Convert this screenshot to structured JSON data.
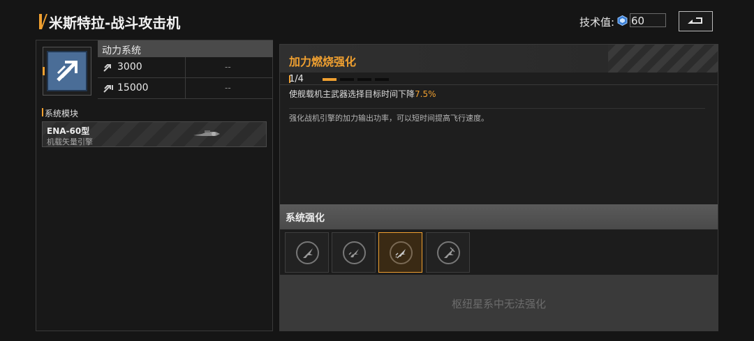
{
  "header": {
    "title": "米斯特拉-战斗攻击机",
    "tech_label": "技术值:",
    "tech_value": "60",
    "back_icon": "back-arrow-icon"
  },
  "left": {
    "system_title": "动力系统",
    "stats": [
      {
        "icon": "thrust-icon",
        "value": "3000",
        "other": "--"
      },
      {
        "icon": "boost-thrust-icon",
        "value": "15000",
        "other": "--"
      }
    ],
    "module_section_label": "系统模块",
    "module": {
      "name": "ENA-60型",
      "subtitle": "机载矢量引擎"
    }
  },
  "right": {
    "title": "加力燃烧强化",
    "level": "1/4",
    "level_progress": {
      "current": 1,
      "max": 4
    },
    "effect_prefix": "使舰载机主武器选择目标时间下降",
    "effect_value": "7.5%",
    "description": "强化战机引擎的加力输出功率，可以短时间提高飞行速度。",
    "enhance_title": "系统强化",
    "slots": [
      {
        "icon": "jet-icon",
        "selected": false
      },
      {
        "icon": "jet-boost-icon",
        "selected": false
      },
      {
        "icon": "jet-afterburner-icon",
        "selected": true
      },
      {
        "icon": "jet-disabled-icon",
        "selected": false
      }
    ],
    "locked_text": "枢纽星系中无法强化"
  },
  "colors": {
    "accent": "#f0a030",
    "background": "#151515",
    "module_icon_bg": "#4a6d97"
  }
}
